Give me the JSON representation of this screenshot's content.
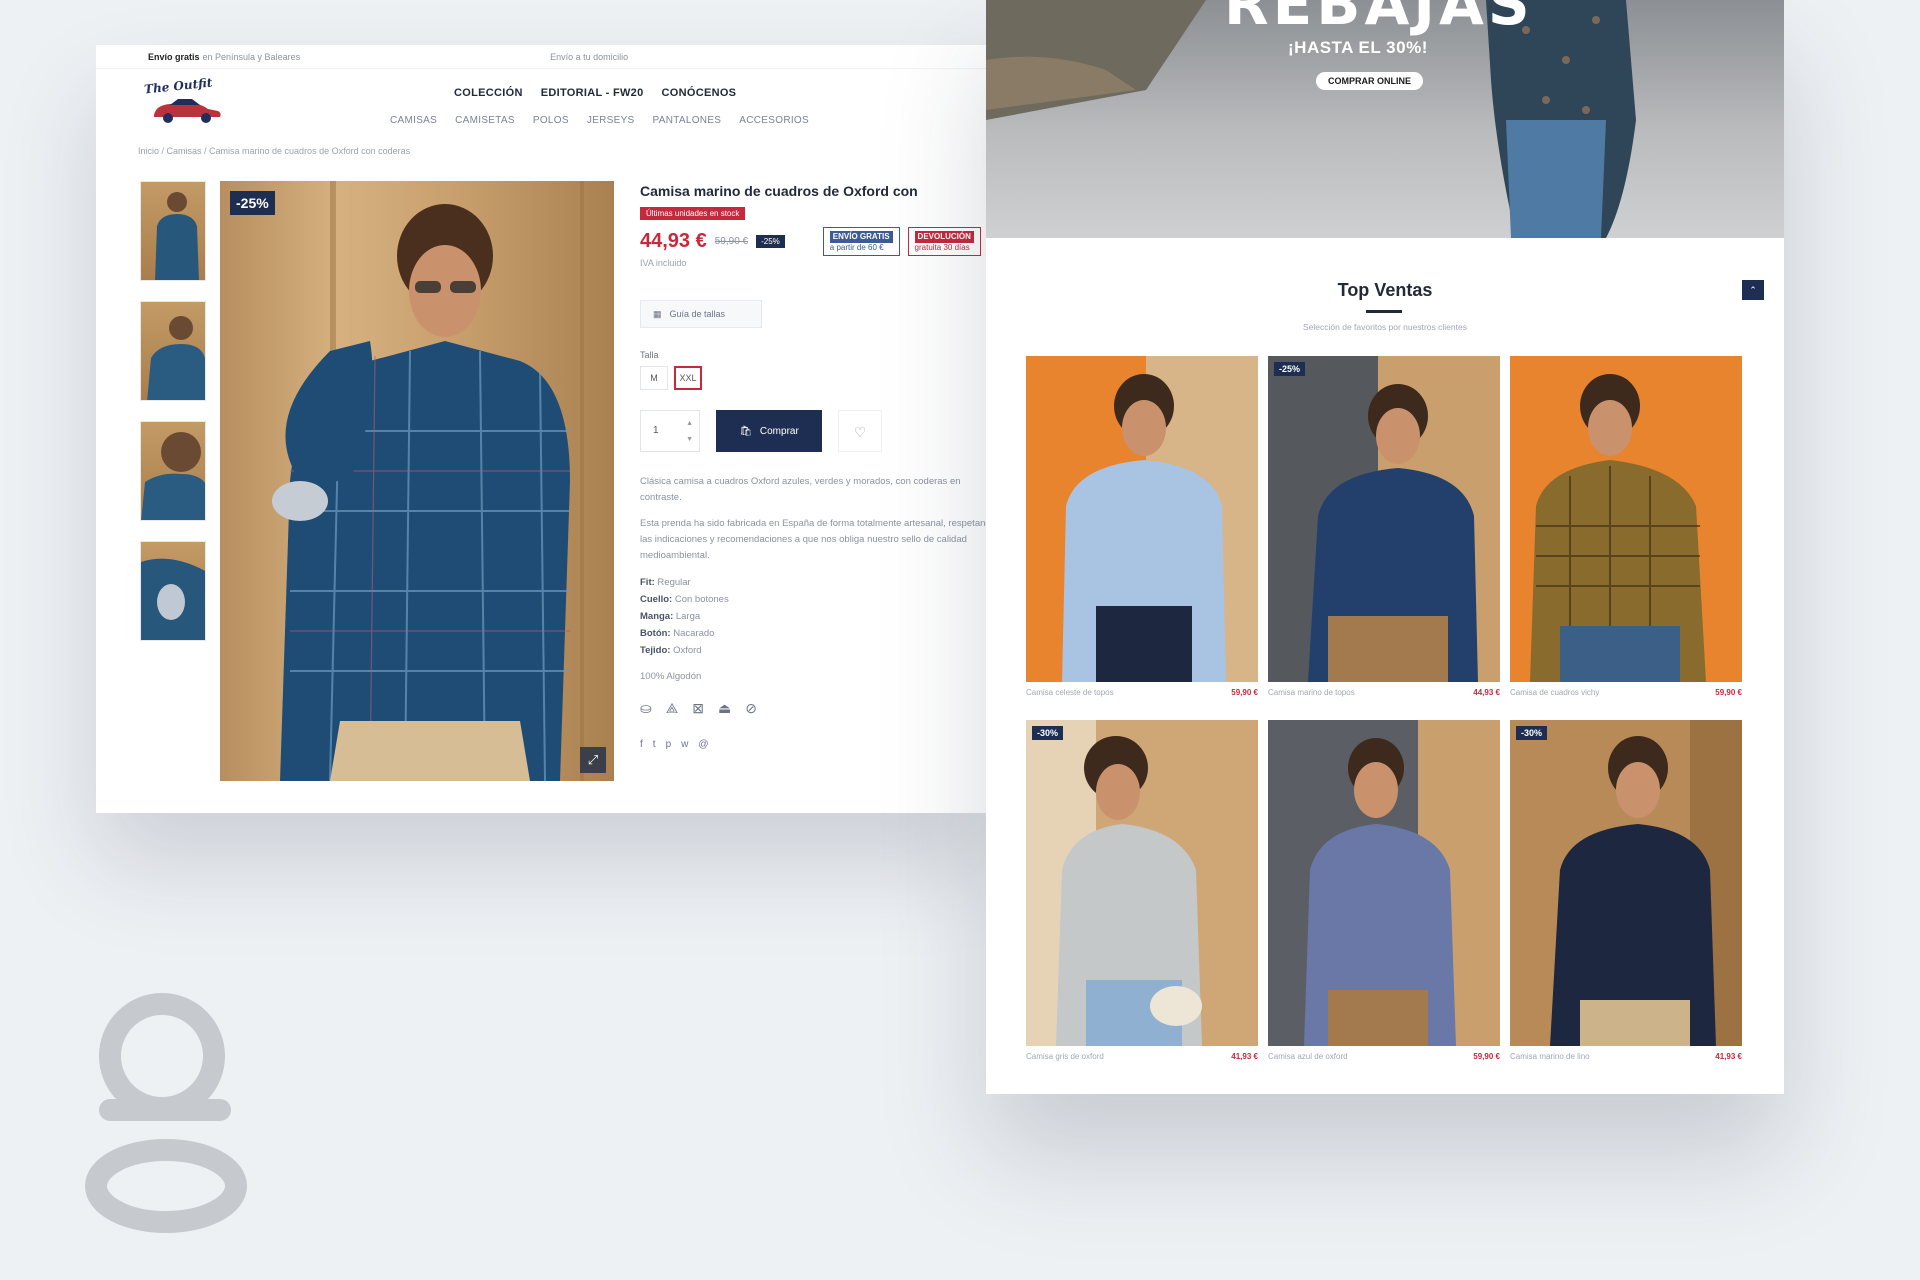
{
  "product_page": {
    "topbar": {
      "free_shipping": "Envío gratis",
      "free_shipping_rest": "en Península y Baleares",
      "promo": "Envío a tu domicilio"
    },
    "logo_text": "The Outfit",
    "main_nav": [
      "COLECCIÓN",
      "EDITORIAL - FW20",
      "CONÓCENOS"
    ],
    "sub_nav": [
      "CAMISAS",
      "CAMISETAS",
      "POLOS",
      "JERSEYS",
      "PANTALONES",
      "ACCESORIOS"
    ],
    "breadcrumb": "Inicio / Camisas / Camisa marino de cuadros de Oxford con coderas",
    "badge": "-25%",
    "title": "Camisa marino de cuadros de Oxford con",
    "stock_tag": "Últimas unidades en stock",
    "price": "44,93 €",
    "old_price": "59,90 €",
    "discount": "-25%",
    "shipping_chip": {
      "title": "ENVÍO GRATIS",
      "text": "a partir de 60 €"
    },
    "returns_chip": {
      "title": "DEVOLUCIÓN",
      "text": "gratuita 30 días"
    },
    "vat": "IVA incluido",
    "size_guide": "Guía de tallas",
    "size_label": "Talla",
    "sizes": [
      "M",
      "XXL"
    ],
    "active_size": "XXL",
    "qty": "1",
    "buy_label": "Comprar",
    "description": [
      "Clásica camisa a cuadros Oxford azules, verdes y morados, con coderas en contraste.",
      "Esta prenda ha sido fabricada en España de forma totalmente artesanal, respetando las indicaciones y recomendaciones a que nos obliga nuestro sello de calidad medioambiental."
    ],
    "specs": [
      {
        "k": "Fit:",
        "v": "Regular"
      },
      {
        "k": "Cuello:",
        "v": "Con botones"
      },
      {
        "k": "Manga:",
        "v": "Larga"
      },
      {
        "k": "Botón:",
        "v": "Nacarado"
      },
      {
        "k": "Tejido:",
        "v": "Oxford"
      }
    ],
    "material": "100% Algodón",
    "care_icons": [
      "wash-icon",
      "no-bleach-icon",
      "tumble-dry-icon",
      "iron-icon",
      "dry-clean-icon"
    ],
    "share_icons": [
      "f",
      "t",
      "p",
      "w",
      "@"
    ]
  },
  "home_page": {
    "hero_title": "REBAJAS",
    "hero_sub": "¡HASTA EL 30%!",
    "hero_cta": "COMPRAR ONLINE",
    "section_title": "Top Ventas",
    "section_sub": "Selección de favoritos por nuestros clientes",
    "products": [
      {
        "badge": "",
        "name": "Camisa celeste de topos",
        "price": "59,90 €",
        "bg": "#e8832e"
      },
      {
        "badge": "-25%",
        "name": "Camisa marino de topos",
        "price": "44,93 €",
        "bg": "#55585d"
      },
      {
        "badge": "",
        "name": "Camisa de cuadros vichy",
        "price": "59,90 €",
        "bg": "#e8832e"
      },
      {
        "badge": "-30%",
        "name": "Camisa gris de oxford",
        "price": "41,93 €",
        "bg": "#cfa676"
      },
      {
        "badge": "",
        "name": "Camisa azul de oxford",
        "price": "59,90 €",
        "bg": "#5b5e64"
      },
      {
        "badge": "-30%",
        "name": "Camisa marino de lino",
        "price": "41,93 €",
        "bg": "#b88a58"
      }
    ]
  },
  "colors": {
    "navy": "#1e2e52",
    "sale_red": "#c8283c",
    "background": "#eef1f4"
  }
}
